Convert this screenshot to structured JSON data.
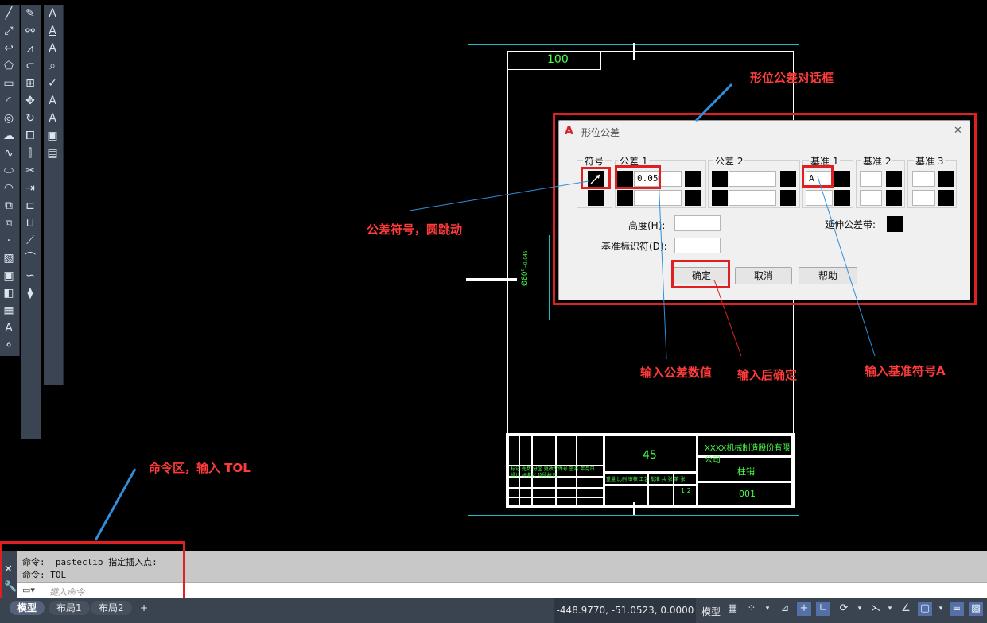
{
  "drawing": {
    "dim_100": "100",
    "dim_vertical": "Ø80⁰₋₀.₀₄₆",
    "title_block": {
      "part_no": "45",
      "company": "XXXX机械制造股份有限公司",
      "part_name": "柱销",
      "drawing_no": "001",
      "scale": "1:2",
      "row_labels": [
        "标记",
        "处数",
        "分区",
        "更改文件号",
        "签名",
        "年月日",
        "设计",
        "标准化",
        "阶段标记",
        "重量",
        "比例",
        "审核",
        "工艺",
        "批准",
        "共",
        "张",
        "第",
        "张"
      ]
    }
  },
  "dialog": {
    "title": "形位公差",
    "close_glyph": "✕",
    "symbol_label": "符号",
    "tolerance1_label": "公差 1",
    "tolerance2_label": "公差 2",
    "datum1_label": "基准 1",
    "datum2_label": "基准 2",
    "datum3_label": "基准 3",
    "tolerance1_value": "0.05",
    "datum1_value": "A",
    "height_label": "高度(H):",
    "datum_id_label": "基准标识符(D):",
    "projected_zone_label": "延伸公差带:",
    "ok_label": "确定",
    "cancel_label": "取消",
    "help_label": "帮助"
  },
  "annotations": {
    "dialog_label": "形位公差对话框",
    "symbol_note": "公差符号，圆跳动",
    "tolerance_note": "输入公差数值",
    "confirm_note": "输入后确定",
    "datum_note": "输入基准符号A",
    "command_note": "命令区，输入 TOL",
    "accent_color": "#e02020",
    "line_color": "#2f8fdc"
  },
  "command": {
    "line1": "命令: _pasteclip 指定插入点:",
    "line2": "命令: TOL",
    "placeholder": "键入命令"
  },
  "status": {
    "tabs": [
      "模型",
      "布局1",
      "布局2"
    ],
    "add_tab": "+",
    "coordinates": "-448.9770, -51.0523, 0.0000",
    "model_label": "模型"
  },
  "toolbar_icons": {
    "col1": [
      "line-icon",
      "polyline-icon",
      "arc-tool-icon",
      "polygon-icon",
      "rectangle-icon",
      "arc-icon",
      "circle-icon",
      "revcloud-icon",
      "spline-icon",
      "ellipse-icon",
      "ellipse-arc-icon",
      "insert-block-icon",
      "make-block-icon",
      "point-icon",
      "hatch-icon",
      "region-icon",
      "wipeout-icon",
      "table-icon",
      "text-icon",
      "add-selected-icon"
    ],
    "col2": [
      "erase-icon",
      "copy-icon",
      "mirror-icon",
      "offset-icon",
      "array-icon",
      "move-icon",
      "rotate-icon",
      "scale-icon",
      "stretch-icon",
      "trim-icon",
      "extend-icon",
      "break-icon",
      "join-icon",
      "chamfer-icon",
      "fillet-icon",
      "blend-icon",
      "explode-icon"
    ],
    "col3": [
      "mtext-icon",
      "single-text-icon",
      "text-edit-icon",
      "find-icon",
      "spellcheck-icon",
      "text-style-icon",
      "text-align-icon",
      "text-frame-icon",
      "text-mask-icon"
    ]
  }
}
